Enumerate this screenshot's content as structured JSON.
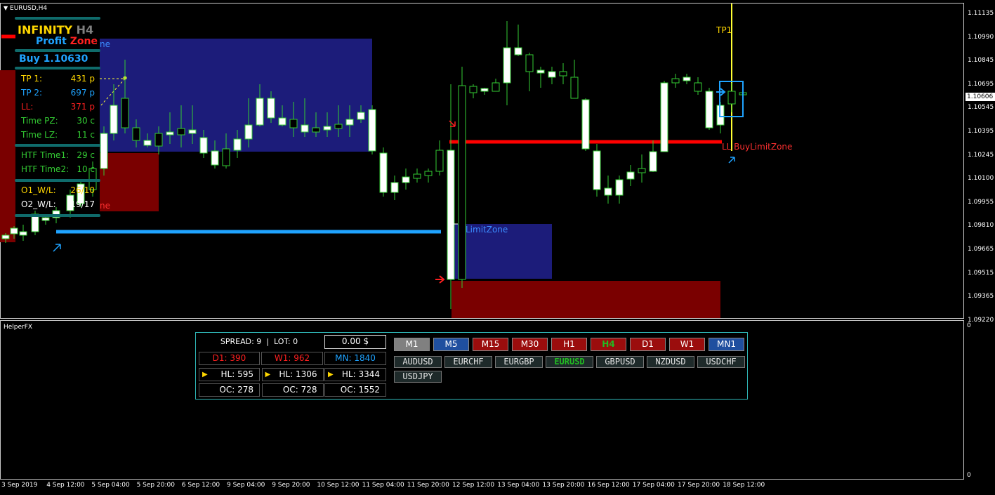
{
  "window": {
    "title": "EURUSD,H4",
    "indicator_title": "HelperFX"
  },
  "colors": {
    "bull": "#ffffff",
    "bear": "#ffffff",
    "wick": "#33cc33",
    "zone_blue": "#1c1c7a",
    "zone_red": "#7a0000",
    "line_red": "#ff0000",
    "line_blue": "#1fa3ff",
    "tp_line": "#ffff33"
  },
  "price_axis": [
    "1.11135",
    "1.10990",
    "1.10845",
    "1.10695",
    "1.10545",
    "1.10395",
    "1.10245",
    "1.10100",
    "1.09955",
    "1.09810",
    "1.09665",
    "1.09515",
    "1.09365",
    "1.09220"
  ],
  "current_price": "1.10606",
  "sub_axis": {
    "top": "0",
    "bottom": "0"
  },
  "time_axis": [
    "3 Sep 2019",
    "4 Sep 12:00",
    "5 Sep 04:00",
    "5 Sep 20:00",
    "6 Sep 12:00",
    "9 Sep 04:00",
    "9 Sep 20:00",
    "10 Sep 12:00",
    "11 Sep 04:00",
    "11 Sep 20:00",
    "12 Sep 12:00",
    "13 Sep 04:00",
    "13 Sep 20:00",
    "16 Sep 12:00",
    "17 Sep 04:00",
    "17 Sep 20:00",
    "18 Sep 12:00"
  ],
  "chart_labels": {
    "tp1": "TP1",
    "ll_buy_limit": "LL BuyLimitZone",
    "limit_zone": "LimitZone",
    "zone_frag_1": "ne",
    "zone_frag_2": "ne"
  },
  "info_panel": {
    "brand_1": "INFINITY",
    "brand_2": "H4",
    "brand_3": "Profit",
    "brand_4": "Zone",
    "buy_label": "Buy 1.10630",
    "rows": [
      {
        "label": "TP 1:",
        "value": "431 p",
        "color": "#ffd700"
      },
      {
        "label": "TP 2:",
        "value": "697 p",
        "color": "#1fa3ff"
      },
      {
        "label": "LL:",
        "value": "371 p",
        "color": "#ff2020"
      },
      {
        "label": "Time PZ:",
        "value": "30 c",
        "color": "#33cc33"
      },
      {
        "label": "Time LZ:",
        "value": "11 c",
        "color": "#33cc33"
      }
    ],
    "htf_rows": [
      {
        "label": "HTF Time1:",
        "value": "29 c",
        "color": "#33cc33"
      },
      {
        "label": "HTF Time2:",
        "value": "10 c",
        "color": "#33cc33"
      }
    ],
    "wl_rows": [
      {
        "label": "O1_W/L:",
        "value": "26/10",
        "color": "#ffd700"
      },
      {
        "label": "O2_W/L:",
        "value": "19/17",
        "color": "#ffffff"
      }
    ]
  },
  "helper": {
    "spread_lot": "SPREAD: 9  |  LOT: 0",
    "profit": "0.00 $",
    "d1": "D1: 390",
    "w1": "W1: 962",
    "mn": "MN: 1840",
    "hl": [
      "HL: 595",
      "HL: 1306",
      "HL: 3344"
    ],
    "oc": [
      "OC: 278",
      "OC: 728",
      "OC: 1552"
    ],
    "timeframes": [
      {
        "label": "M1",
        "bg": "#808080",
        "fg": "#ffffff"
      },
      {
        "label": "M5",
        "bg": "#1f4f9f",
        "fg": "#ffffff"
      },
      {
        "label": "M15",
        "bg": "#9b0d0d",
        "fg": "#ffffff"
      },
      {
        "label": "M30",
        "bg": "#9b0d0d",
        "fg": "#ffffff"
      },
      {
        "label": "H1",
        "bg": "#9b0d0d",
        "fg": "#ffffff"
      },
      {
        "label": "H4",
        "bg": "#9b0d0d",
        "fg": "#22bb22"
      },
      {
        "label": "D1",
        "bg": "#9b0d0d",
        "fg": "#ffffff"
      },
      {
        "label": "W1",
        "bg": "#9b0d0d",
        "fg": "#ffffff"
      },
      {
        "label": "MN1",
        "bg": "#1f4f9f",
        "fg": "#ffffff"
      }
    ],
    "symbols": [
      "AUDUSD",
      "EURCHF",
      "EURGBP",
      "EURUSD",
      "GBPUSD",
      "NZDUSD",
      "USDCHF",
      "USDJPY"
    ],
    "active_symbol": "EURUSD"
  }
}
